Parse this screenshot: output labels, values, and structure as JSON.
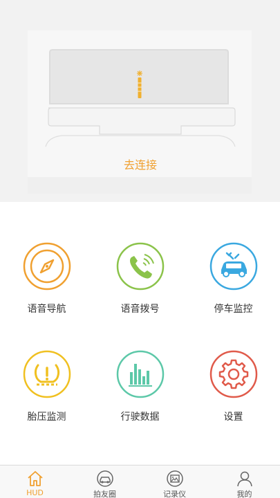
{
  "device": {
    "connect_label": "去连接"
  },
  "features": [
    {
      "label": "语音导航",
      "icon": "compass-icon",
      "color": "#f0a030"
    },
    {
      "label": "语音拨号",
      "icon": "phone-icon",
      "color": "#8bc34a"
    },
    {
      "label": "停车监控",
      "icon": "car-monitor-icon",
      "color": "#3aa8e0"
    },
    {
      "label": "胎压监测",
      "icon": "tire-pressure-icon",
      "color": "#f0c020"
    },
    {
      "label": "行驶数据",
      "icon": "bar-chart-icon",
      "color": "#5cc8a8"
    },
    {
      "label": "设置",
      "icon": "gear-icon",
      "color": "#e05a4a"
    }
  ],
  "tabs": [
    {
      "label": "HUD",
      "icon": "home-icon",
      "active": true
    },
    {
      "label": "拍友圈",
      "icon": "car-circle-icon",
      "active": false
    },
    {
      "label": "记录仪",
      "icon": "picture-icon",
      "active": false
    },
    {
      "label": "我的",
      "icon": "user-icon",
      "active": false
    }
  ],
  "colors": {
    "accent": "#f0a030",
    "tab_inactive": "#555555"
  }
}
